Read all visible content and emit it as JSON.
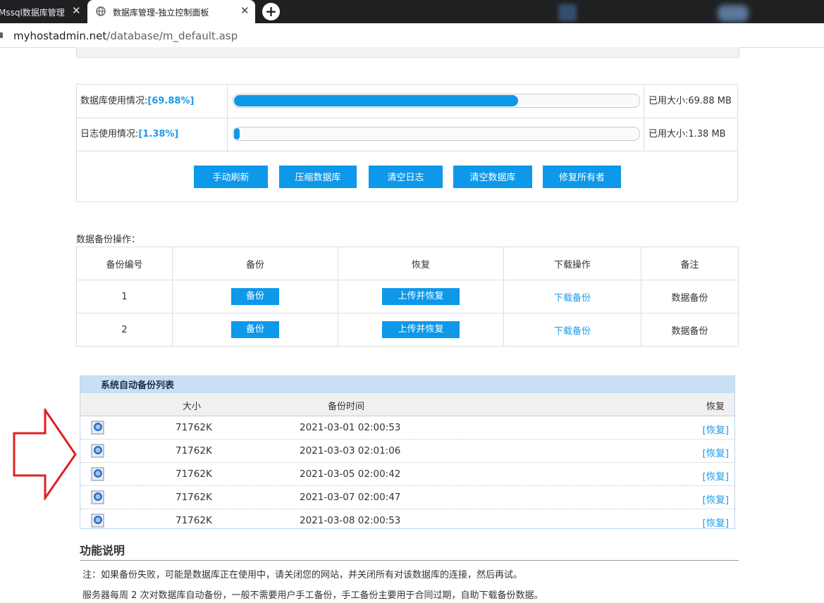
{
  "browser": {
    "tabs": [
      {
        "title": "Mssql数据库管理",
        "active": false
      },
      {
        "title": "数据库管理-独立控制面板",
        "active": true
      }
    ],
    "close_glyph": "✕",
    "new_tab_glyph": "+",
    "url_host": "myhostadmin.net",
    "url_path": "/database/m_default.asp"
  },
  "usage": {
    "rows": [
      {
        "label": "数据库使用情况:",
        "percent_text": "[69.88%]",
        "percent": 69.88,
        "size_text": "已用大小:69.88 MB"
      },
      {
        "label": "日志使用情况:",
        "percent_text": "[1.38%]",
        "percent": 1.38,
        "size_text": "已用大小:1.38 MB"
      }
    ],
    "buttons": [
      "手动刷新",
      "压缩数据库",
      "清空日志",
      "清空数据库",
      "修复所有者"
    ]
  },
  "backup_ops": {
    "label": "数据备份操作：",
    "headers": [
      "备份编号",
      "备份",
      "恢复",
      "下载操作",
      "备注"
    ],
    "rows": [
      {
        "id": "1",
        "backup": "备份",
        "restore": "上传并恢复",
        "download": "下载备份",
        "note": "数据备份"
      },
      {
        "id": "2",
        "backup": "备份",
        "restore": "上传并恢复",
        "download": "下载备份",
        "note": "数据备份"
      }
    ]
  },
  "auto_backup": {
    "title": "系统自动备份列表",
    "headers": {
      "size": "大小",
      "time": "备份时间",
      "restore": "恢复"
    },
    "rows": [
      {
        "size": "71762K",
        "time": "2021-03-01 02:00:53",
        "restore": "[恢复]"
      },
      {
        "size": "71762K",
        "time": "2021-03-03 02:01:06",
        "restore": "[恢复]"
      },
      {
        "size": "71762K",
        "time": "2021-03-05 02:00:42",
        "restore": "[恢复]"
      },
      {
        "size": "71762K",
        "time": "2021-03-07 02:00:47",
        "restore": "[恢复]"
      },
      {
        "size": "71762K",
        "time": "2021-03-08 02:00:53",
        "restore": "[恢复]"
      }
    ]
  },
  "func": {
    "title": "功能说明",
    "notes": [
      "注：如果备份失败，可能是数据库正在使用中，请关闭您的网站，并关闭所有对该数据库的连接，然后再试。",
      "服务器每周 2 次对数据库自动备份，一般不需要用户手工备份，手工备份主要用于合同过期，自助下载备份数据。"
    ]
  },
  "colors": {
    "accent": "#0d98ea",
    "link": "#1e9be8",
    "arrow": "#e02020"
  }
}
